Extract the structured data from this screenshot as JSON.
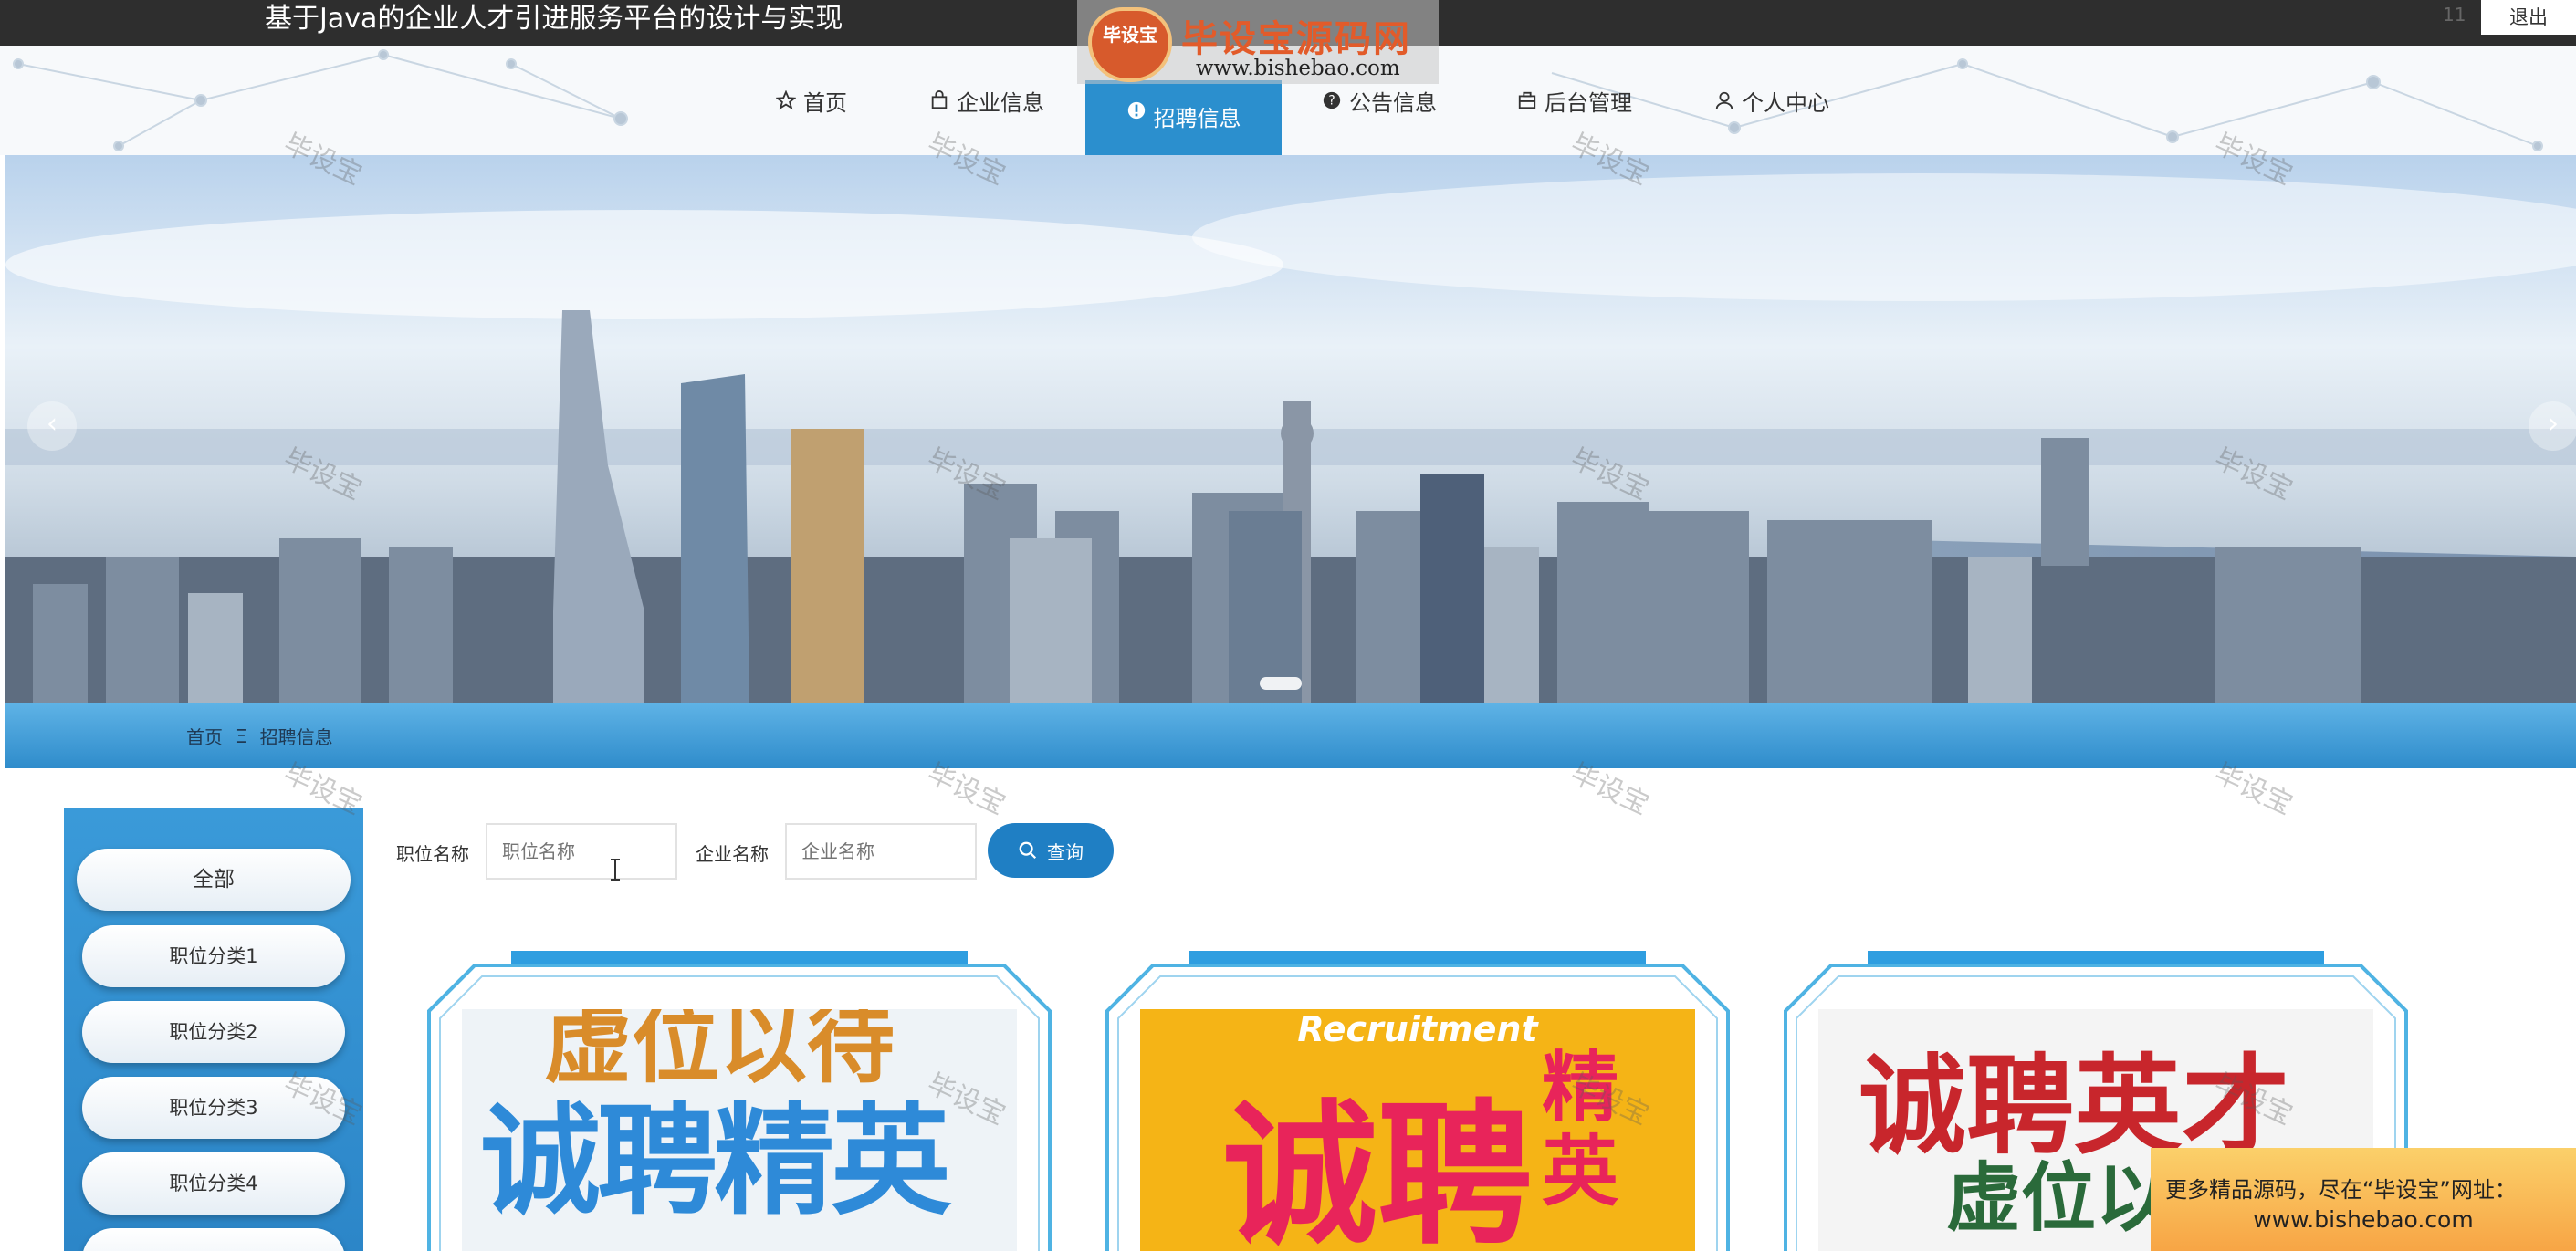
{
  "app": {
    "title": "基于Java的企业人才引进服务平台的设计与实现",
    "user": "11",
    "logout_label": "退出"
  },
  "watermark": {
    "logo_badge": "毕设宝",
    "logo_text": "毕设宝源码网",
    "logo_url": "www.bishebao.com",
    "repeat_text": "毕设宝"
  },
  "nav": {
    "items": [
      {
        "label": "首页",
        "icon": "star-icon"
      },
      {
        "label": "企业信息",
        "icon": "bag-icon"
      },
      {
        "label": "招聘信息",
        "icon": "info-circle-icon",
        "active": true
      },
      {
        "label": "公告信息",
        "icon": "question-circle-icon"
      },
      {
        "label": "后台管理",
        "icon": "briefcase-icon"
      },
      {
        "label": "个人中心",
        "icon": "user-icon"
      }
    ]
  },
  "banner": {
    "prev_icon": "chevron-left-icon",
    "next_icon": "chevron-right-icon",
    "prev_glyph": "‹",
    "next_glyph": "›"
  },
  "breadcrumb": {
    "home": "首页",
    "separator": "Ξ",
    "current": "招聘信息"
  },
  "sidebar": {
    "items": [
      "全部",
      "职位分类1",
      "职位分类2",
      "职位分类3",
      "职位分类4"
    ]
  },
  "search": {
    "job_label": "职位名称",
    "job_placeholder": "职位名称",
    "company_label": "企业名称",
    "company_placeholder": "企业名称",
    "button_label": "查询"
  },
  "cards": [
    {
      "poster_line1": "虚位以待",
      "poster_line2": "诚聘精英"
    },
    {
      "poster_top": "Recruitment",
      "poster_main": "诚聘",
      "poster_side": "精英"
    },
    {
      "poster_line1": "诚聘英才",
      "poster_line2": "虚位以待"
    }
  ],
  "ad": {
    "line1": "更多精品源码，尽在“毕设宝”网址：",
    "line2": "www.bishebao.com"
  },
  "colors": {
    "accent": "#2b8fce",
    "topbar": "#2e2e2e",
    "search_button": "#1f7fc4"
  }
}
